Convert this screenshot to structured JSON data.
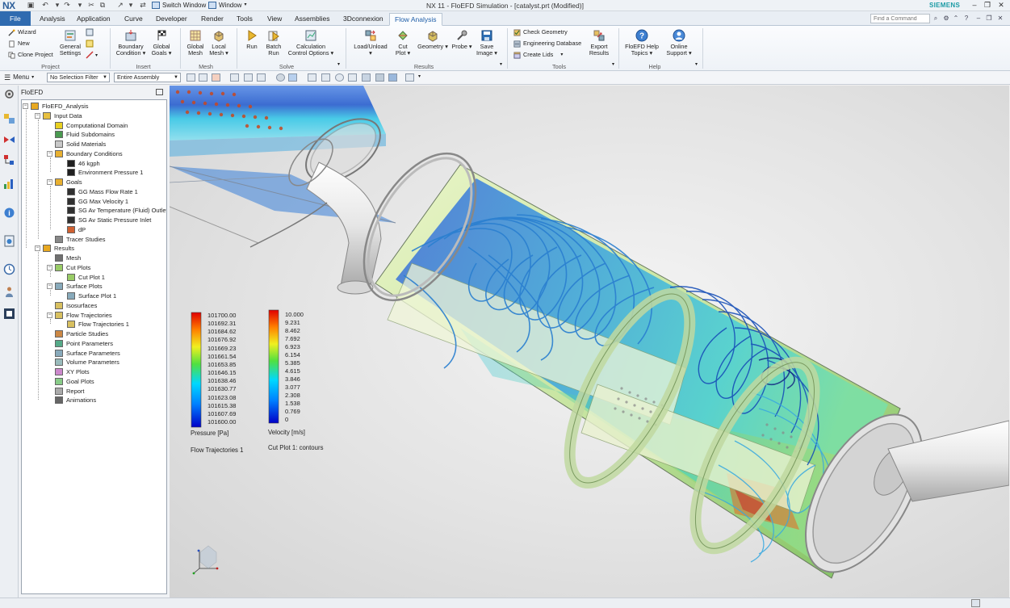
{
  "titlebar": {
    "logo": "NX",
    "switch_window": "Switch Window",
    "window_menu": "Window",
    "title": "NX 11 - FloEFD Simulation - [catalyst.prt (Modified)]",
    "brand": "SIEMENS"
  },
  "tabs": [
    {
      "label": "File"
    },
    {
      "label": "Analysis"
    },
    {
      "label": "Application"
    },
    {
      "label": "Curve"
    },
    {
      "label": "Developer"
    },
    {
      "label": "Render"
    },
    {
      "label": "Tools"
    },
    {
      "label": "View"
    },
    {
      "label": "Assemblies"
    },
    {
      "label": "3Dconnexion"
    },
    {
      "label": "Flow Analysis"
    }
  ],
  "command_finder": {
    "placeholder": "Find a Command"
  },
  "ribbon": {
    "project": {
      "wizard": "Wizard",
      "new": "New",
      "clone": "Clone Project",
      "general_1": "General",
      "general_2": "Settings",
      "label": "Project"
    },
    "insert": {
      "bc_1": "Boundary",
      "bc_2": "Condition",
      "goals_1": "Global",
      "goals_2": "Goals",
      "label": "Insert"
    },
    "mesh": {
      "global_1": "Global",
      "global_2": "Mesh",
      "local_1": "Local",
      "local_2": "Mesh",
      "label": "Mesh"
    },
    "solve": {
      "run": "Run",
      "batch_1": "Batch",
      "batch_2": "Run",
      "calc_1": "Calculation",
      "calc_2": "Control Options",
      "label": "Solve"
    },
    "results": {
      "load_1": "Load/Unload",
      "cut_1": "Cut",
      "cut_2": "Plot",
      "geometry_1": "Geometry",
      "probe_1": "Probe",
      "save_1": "Save",
      "save_2": "Image",
      "label": "Results"
    },
    "tools": {
      "check": "Check Geometry",
      "engdb": "Engineering Database",
      "lids": "Create Lids",
      "export_1": "Export",
      "export_2": "Results",
      "label": "Tools"
    },
    "help": {
      "floefd_1": "FloEFD Help",
      "floefd_2": "Topics",
      "online_1": "Online",
      "online_2": "Support",
      "label": "Help"
    }
  },
  "selection_bar": {
    "menu": "Menu",
    "filter": "No Selection Filter",
    "scope": "Entire Assembly"
  },
  "navigator": {
    "title": "FloEFD",
    "items": [
      {
        "label": "FloEFD_Analysis",
        "icon": "analysis-icon"
      },
      {
        "label": "Input Data",
        "icon": "folder-icon"
      },
      {
        "label": "Computational Domain",
        "icon": "domain-icon"
      },
      {
        "label": "Fluid Subdomains",
        "icon": "fluid-icon"
      },
      {
        "label": "Solid Materials",
        "icon": "solid-icon"
      },
      {
        "label": "Boundary Conditions",
        "icon": "bc-folder-icon"
      },
      {
        "label": "46 kgph",
        "icon": "flag-icon"
      },
      {
        "label": "Environment Pressure 1",
        "icon": "flag-icon"
      },
      {
        "label": "Goals",
        "icon": "goals-icon"
      },
      {
        "label": "GG Mass Flow Rate 1",
        "icon": "goal-flag-icon"
      },
      {
        "label": "GG Max Velocity 1",
        "icon": "goal-flag-icon"
      },
      {
        "label": "SG Av Temperature (Fluid) Outlet",
        "icon": "goal-flag-icon"
      },
      {
        "label": "SG Av Static Pressure Inlet",
        "icon": "goal-flag-icon"
      },
      {
        "label": "dP",
        "icon": "equation-goal-icon"
      },
      {
        "label": "Tracer Studies",
        "icon": "tracer-icon"
      },
      {
        "label": "Results",
        "icon": "results-icon"
      },
      {
        "label": "Mesh",
        "icon": "mesh-icon"
      },
      {
        "label": "Cut Plots",
        "icon": "cutplot-icon"
      },
      {
        "label": "Cut Plot 1",
        "icon": "cutplot-icon"
      },
      {
        "label": "Surface Plots",
        "icon": "surface-icon"
      },
      {
        "label": "Surface Plot 1",
        "icon": "surface-icon"
      },
      {
        "label": "Isosurfaces",
        "icon": "iso-icon"
      },
      {
        "label": "Flow Trajectories",
        "icon": "trajectory-icon"
      },
      {
        "label": "Flow Trajectories 1",
        "icon": "trajectory-icon"
      },
      {
        "label": "Particle Studies",
        "icon": "particle-icon"
      },
      {
        "label": "Point Parameters",
        "icon": "point-icon"
      },
      {
        "label": "Surface Parameters",
        "icon": "surface-param-icon"
      },
      {
        "label": "Volume Parameters",
        "icon": "volume-icon"
      },
      {
        "label": "XY Plots",
        "icon": "xy-icon"
      },
      {
        "label": "Goal Plots",
        "icon": "goalplot-icon"
      },
      {
        "label": "Report",
        "icon": "report-icon"
      },
      {
        "label": "Animations",
        "icon": "animation-icon"
      }
    ]
  },
  "legend_pressure": {
    "values": [
      "101700.00",
      "101692.31",
      "101684.62",
      "101676.92",
      "101669.23",
      "101661.54",
      "101653.85",
      "101646.15",
      "101638.46",
      "101630.77",
      "101623.08",
      "101615.38",
      "101607.69",
      "101600.00"
    ],
    "title": "Pressure [Pa]",
    "caption": "Flow Trajectories 1"
  },
  "legend_velocity": {
    "values": [
      "10.000",
      "9.231",
      "8.462",
      "7.692",
      "6.923",
      "6.154",
      "5.385",
      "4.615",
      "3.846",
      "3.077",
      "2.308",
      "1.538",
      "0.769",
      "0"
    ],
    "title": "Velocity [m/s]",
    "caption": "Cut Plot 1: contours"
  },
  "colors": {
    "nx_blue": "#2f6bb0",
    "siemens_teal": "#1a9aa4",
    "streamline": "#2a7fd0"
  }
}
